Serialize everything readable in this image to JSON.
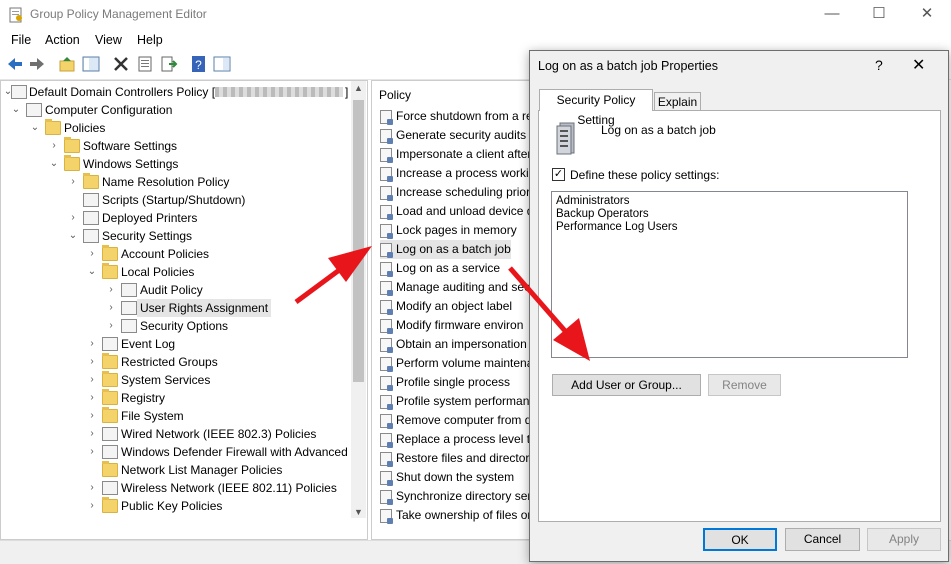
{
  "window": {
    "title": "Group Policy Management Editor",
    "minimize_glyph": "—",
    "maximize_glyph": "☐",
    "close_glyph": "✕"
  },
  "menu": [
    "File",
    "Action",
    "View",
    "Help"
  ],
  "toolbar_icons": [
    "back-arrow-icon",
    "forward-arrow-icon",
    "up-folder-icon",
    "show-hide-tree-icon",
    "delete-icon",
    "properties-icon",
    "export-list-icon",
    "help-icon",
    "show-pane-icon"
  ],
  "tree": {
    "root": "Default Domain Controllers Policy [",
    "items": [
      {
        "label": "Computer Configuration",
        "icon": "computer-icon"
      },
      {
        "label": "Policies",
        "icon": "folder-icon"
      },
      {
        "label": "Software Settings",
        "icon": "folder-icon"
      },
      {
        "label": "Windows Settings",
        "icon": "folder-icon"
      },
      {
        "label": "Name Resolution Policy",
        "icon": "folder-icon"
      },
      {
        "label": "Scripts (Startup/Shutdown)",
        "icon": "script-icon"
      },
      {
        "label": "Deployed Printers",
        "icon": "printer-icon"
      },
      {
        "label": "Security Settings",
        "icon": "security-icon"
      },
      {
        "label": "Account Policies",
        "icon": "folder-icon"
      },
      {
        "label": "Local Policies",
        "icon": "folder-icon"
      },
      {
        "label": "Audit Policy",
        "icon": "policy-icon"
      },
      {
        "label": "User Rights Assignment",
        "icon": "policy-icon"
      },
      {
        "label": "Security Options",
        "icon": "policy-icon"
      },
      {
        "label": "Event Log",
        "icon": "policy-icon"
      },
      {
        "label": "Restricted Groups",
        "icon": "folder-lock-icon"
      },
      {
        "label": "System Services",
        "icon": "folder-lock-icon"
      },
      {
        "label": "Registry",
        "icon": "folder-lock-icon"
      },
      {
        "label": "File System",
        "icon": "folder-lock-icon"
      },
      {
        "label": "Wired Network (IEEE 802.3) Policies",
        "icon": "network-icon"
      },
      {
        "label": "Windows Defender Firewall with Advanced",
        "icon": "firewall-icon"
      },
      {
        "label": "Network List Manager Policies",
        "icon": "folder-icon"
      },
      {
        "label": "Wireless Network (IEEE 802.11) Policies",
        "icon": "wireless-icon"
      },
      {
        "label": "Public Key Policies",
        "icon": "folder-icon"
      }
    ]
  },
  "policy_pane": {
    "header": "Policy",
    "items": [
      "Force shutdown from a re",
      "Generate security audits",
      "Impersonate a client after",
      "Increase a process workin",
      "Increase scheduling priori",
      "Load and unload device d",
      "Lock pages in memory",
      "Log on as a batch job",
      "Log on as a service",
      "Manage auditing and sec",
      "Modify an object label",
      "Modify firmware environ",
      "Obtain an impersonation",
      "Perform volume maintena",
      "Profile single process",
      "Profile system performan",
      "Remove computer from d",
      "Replace a process level to",
      "Restore files and directori",
      "Shut down the system",
      "Synchronize directory serv",
      "Take ownership of files or"
    ],
    "selected_index": 7
  },
  "dialog": {
    "title": "Log on as a batch job Properties",
    "help_glyph": "?",
    "close_glyph": "✕",
    "tabs": [
      "Security Policy Setting",
      "Explain"
    ],
    "policy_name": "Log on as a batch job",
    "define_checked": true,
    "check_glyph": "✓",
    "define_label": "Define these policy settings:",
    "members": [
      "Administrators",
      "Backup Operators",
      "Performance Log Users"
    ],
    "add_button": "Add User or Group...",
    "remove_button": "Remove",
    "ok_button": "OK",
    "cancel_button": "Cancel",
    "apply_button": "Apply"
  },
  "colors": {
    "annotation_arrow": "#e8161b",
    "accent": "#0078d7"
  }
}
